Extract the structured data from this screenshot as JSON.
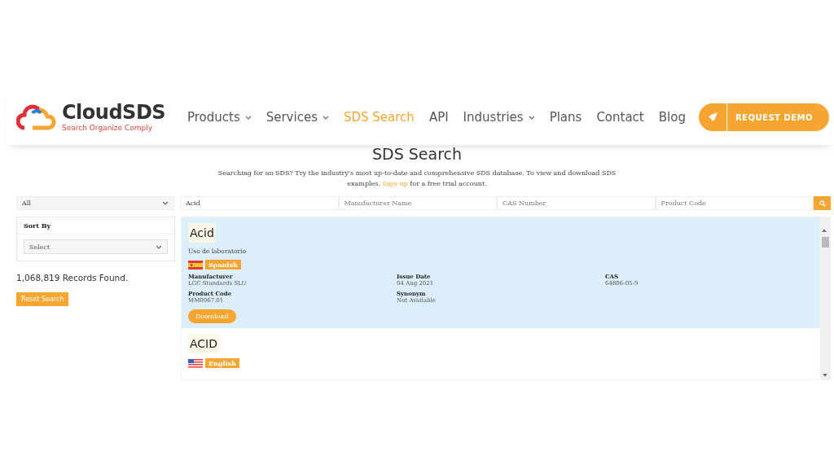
{
  "header": {
    "logo": {
      "name": "CloudSDS",
      "tagline": "Search Organize Comply"
    },
    "nav": [
      {
        "label": "Products",
        "dropdown": true,
        "selected": false
      },
      {
        "label": "Services",
        "dropdown": true,
        "selected": false
      },
      {
        "label": "SDS Search",
        "dropdown": false,
        "selected": true
      },
      {
        "label": "API",
        "dropdown": false,
        "selected": false
      },
      {
        "label": "Industries",
        "dropdown": true,
        "selected": false
      },
      {
        "label": "Plans",
        "dropdown": false,
        "selected": false
      },
      {
        "label": "Contact",
        "dropdown": false,
        "selected": false
      },
      {
        "label": "Blog",
        "dropdown": false,
        "selected": false
      }
    ],
    "cta": "REQUEST DEMO"
  },
  "page_title": "SDS Search",
  "intro": {
    "before": "Searching for an SDS? Try the industry's most up-to-date and comprehensive SDS database. To view and download SDS examples, ",
    "link": "Sign-up",
    "after": " for a free trial account."
  },
  "filters": {
    "category": "All",
    "search_value": "Acid",
    "placeholders": [
      "Manufacturer Name",
      "CAS Number",
      "Product Code"
    ]
  },
  "sidebar": {
    "sort_title": "Sort By",
    "sort_placeholder": "Select",
    "records": "1,068,819 Records Found.",
    "reset": "Reset Search"
  },
  "results": [
    {
      "title": "Acid",
      "selected": true,
      "subtitle": "Uso de laboratorio",
      "kind": "es",
      "language": "Spanish",
      "fields": [
        {
          "label": "Manufacturer",
          "value": "LGC Standards SLU"
        },
        {
          "label": "Issue Date",
          "value": "04 Aug 2021"
        },
        {
          "label": "CAS",
          "value": "64806-05-9"
        },
        {
          "label": "Product Code",
          "value": "MM0067.01"
        },
        {
          "label": "Synonym",
          "value": "Not Available"
        }
      ],
      "button": "Download"
    },
    {
      "title": "ACID",
      "selected": false,
      "kind": "us",
      "language": "English"
    }
  ]
}
